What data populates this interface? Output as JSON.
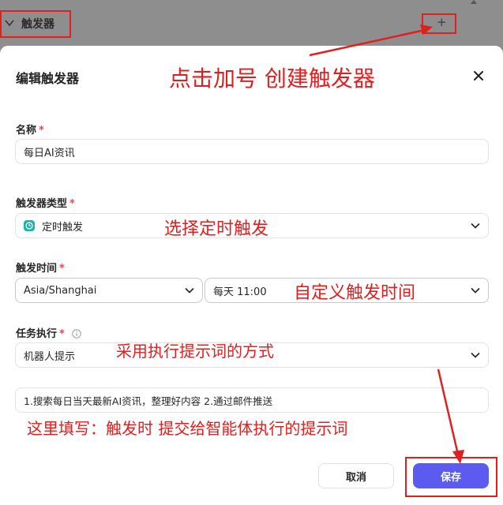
{
  "background": {
    "section_title": "触发器",
    "add_symbol": "+"
  },
  "modal": {
    "title": "编辑触发器",
    "name": {
      "label": "名称",
      "required": "*",
      "value": "每日AI资讯"
    },
    "trigger_type": {
      "label": "触发器类型",
      "required": "*",
      "value": "定时触发"
    },
    "trigger_time": {
      "label": "触发时间",
      "required": "*",
      "timezone": "Asia/Shanghai",
      "schedule": "每天 11:00"
    },
    "task": {
      "label": "任务执行",
      "required": "*",
      "mode": "机器人提示",
      "prompt": "1.搜索每日当天最新AI资讯，整理好内容 2.通过邮件推送"
    },
    "buttons": {
      "cancel": "取消",
      "save": "保存"
    }
  },
  "annotations": {
    "add_trigger": "点击加号 创建触发器",
    "select_timer": "选择定时触发",
    "custom_time": "自定义触发时间",
    "prompt_mode": "采用执行提示词的方式",
    "fill_prompt": "这里填写：触发时 提交给智能体执行的提示词"
  },
  "colors": {
    "accent": "#5b5bf0",
    "annotation": "#e02020",
    "required": "#e5484d",
    "badge": "#20b2aa"
  }
}
